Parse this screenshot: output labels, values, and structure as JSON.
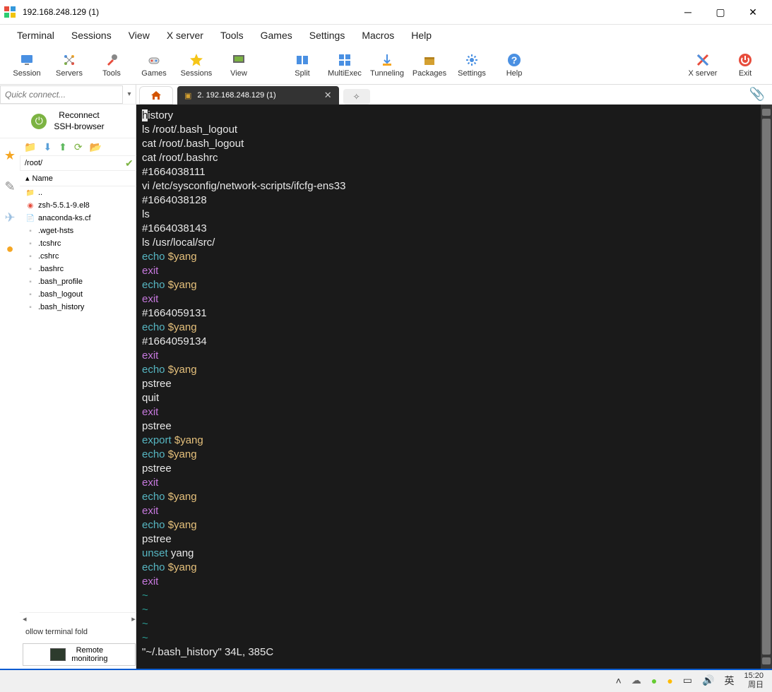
{
  "title": "192.168.248.129 (1)",
  "menu": [
    "Terminal",
    "Sessions",
    "View",
    "X server",
    "Tools",
    "Games",
    "Settings",
    "Macros",
    "Help"
  ],
  "toolbar": [
    {
      "label": "Session",
      "icon": "monitor"
    },
    {
      "label": "Servers",
      "icon": "servers"
    },
    {
      "label": "Tools",
      "icon": "tools"
    },
    {
      "label": "Games",
      "icon": "games"
    },
    {
      "label": "Sessions",
      "icon": "star"
    },
    {
      "label": "View",
      "icon": "view"
    },
    {
      "label": "",
      "icon": ""
    },
    {
      "label": "Split",
      "icon": "split"
    },
    {
      "label": "MultiExec",
      "icon": "multi"
    },
    {
      "label": "Tunneling",
      "icon": "tunnel"
    },
    {
      "label": "Packages",
      "icon": "packages"
    },
    {
      "label": "Settings",
      "icon": "settings"
    },
    {
      "label": "Help",
      "icon": "help"
    }
  ],
  "toolbar_right": [
    {
      "label": "X server",
      "icon": "xserver"
    },
    {
      "label": "Exit",
      "icon": "exit"
    }
  ],
  "quick_connect_placeholder": "Quick connect...",
  "reconnect": {
    "line1": "Reconnect",
    "line2": "SSH-browser"
  },
  "fb_path": "/root/",
  "fb_header": "Name",
  "files": [
    {
      "name": "..",
      "type": "up"
    },
    {
      "name": "zsh-5.5.1-9.el8",
      "type": "rpm"
    },
    {
      "name": "anaconda-ks.cf",
      "type": "doc"
    },
    {
      "name": ".wget-hsts",
      "type": "file"
    },
    {
      "name": ".tcshrc",
      "type": "file"
    },
    {
      "name": ".cshrc",
      "type": "file"
    },
    {
      "name": ".bashrc",
      "type": "file"
    },
    {
      "name": ".bash_profile",
      "type": "file"
    },
    {
      "name": ".bash_logout",
      "type": "file"
    },
    {
      "name": ".bash_history",
      "type": "file"
    }
  ],
  "follow_label": "ollow terminal fold",
  "remote_mon": {
    "line1": "Remote",
    "line2": "monitoring"
  },
  "tab_label": "2. 192.168.248.129 (1)",
  "terminal_lines": [
    [
      {
        "c": "hi",
        "t": "h"
      },
      {
        "c": "c-white",
        "t": "istory"
      }
    ],
    [
      {
        "c": "c-white",
        "t": "ls /root/.bash_logout"
      }
    ],
    [
      {
        "c": "c-white",
        "t": "cat /root/.bash_logout"
      }
    ],
    [
      {
        "c": "c-white",
        "t": "cat /root/.bashrc"
      }
    ],
    [
      {
        "c": "c-white",
        "t": "#1664038111"
      }
    ],
    [
      {
        "c": "c-white",
        "t": "vi /etc/sysconfig/network-scripts/ifcfg-ens33"
      }
    ],
    [
      {
        "c": "c-white",
        "t": "#1664038128"
      }
    ],
    [
      {
        "c": "c-white",
        "t": "ls"
      }
    ],
    [
      {
        "c": "c-white",
        "t": "#1664038143"
      }
    ],
    [
      {
        "c": "c-white",
        "t": "ls /usr/local/src/"
      }
    ],
    [
      {
        "c": "c-cyan",
        "t": "echo"
      },
      {
        "c": "c-white",
        "t": " "
      },
      {
        "c": "c-yellow",
        "t": "$yang"
      }
    ],
    [
      {
        "c": "c-magenta",
        "t": "exit"
      }
    ],
    [
      {
        "c": "c-cyan",
        "t": "echo"
      },
      {
        "c": "c-white",
        "t": " "
      },
      {
        "c": "c-yellow",
        "t": "$yang"
      }
    ],
    [
      {
        "c": "c-magenta",
        "t": "exit"
      }
    ],
    [
      {
        "c": "c-white",
        "t": "#1664059131"
      }
    ],
    [
      {
        "c": "c-cyan",
        "t": "echo"
      },
      {
        "c": "c-white",
        "t": " "
      },
      {
        "c": "c-yellow",
        "t": "$yang"
      }
    ],
    [
      {
        "c": "c-white",
        "t": "#1664059134"
      }
    ],
    [
      {
        "c": "c-magenta",
        "t": "exit"
      }
    ],
    [
      {
        "c": "c-cyan",
        "t": "echo"
      },
      {
        "c": "c-white",
        "t": " "
      },
      {
        "c": "c-yellow",
        "t": "$yang"
      }
    ],
    [
      {
        "c": "c-white",
        "t": "pstree"
      }
    ],
    [
      {
        "c": "c-white",
        "t": "quit"
      }
    ],
    [
      {
        "c": "c-magenta",
        "t": "exit"
      }
    ],
    [
      {
        "c": "c-white",
        "t": "pstree"
      }
    ],
    [
      {
        "c": "c-cyan",
        "t": "export"
      },
      {
        "c": "c-white",
        "t": " "
      },
      {
        "c": "c-yellow",
        "t": "$yang"
      }
    ],
    [
      {
        "c": "c-cyan",
        "t": "echo"
      },
      {
        "c": "c-white",
        "t": " "
      },
      {
        "c": "c-yellow",
        "t": "$yang"
      }
    ],
    [
      {
        "c": "c-white",
        "t": "pstree"
      }
    ],
    [
      {
        "c": "c-magenta",
        "t": "exit"
      }
    ],
    [
      {
        "c": "c-cyan",
        "t": "echo"
      },
      {
        "c": "c-white",
        "t": " "
      },
      {
        "c": "c-yellow",
        "t": "$yang"
      }
    ],
    [
      {
        "c": "c-magenta",
        "t": "exit"
      }
    ],
    [
      {
        "c": "c-cyan",
        "t": "echo"
      },
      {
        "c": "c-white",
        "t": " "
      },
      {
        "c": "c-yellow",
        "t": "$yang"
      }
    ],
    [
      {
        "c": "c-white",
        "t": "pstree"
      }
    ],
    [
      {
        "c": "c-cyan",
        "t": "unset"
      },
      {
        "c": "c-white",
        "t": " yang"
      }
    ],
    [
      {
        "c": "c-cyan",
        "t": "echo"
      },
      {
        "c": "c-white",
        "t": " "
      },
      {
        "c": "c-yellow",
        "t": "$yang"
      }
    ],
    [
      {
        "c": "c-magenta",
        "t": "exit"
      }
    ],
    [
      {
        "c": "c-teal",
        "t": "~"
      }
    ],
    [
      {
        "c": "c-teal",
        "t": "~"
      }
    ],
    [
      {
        "c": "c-teal",
        "t": "~"
      }
    ],
    [
      {
        "c": "c-teal",
        "t": "~"
      }
    ],
    [
      {
        "c": "c-white",
        "t": "\"~/.bash_history\" 34L, 385C"
      }
    ]
  ],
  "taskbar": {
    "time": "15:20",
    "day": "周日",
    "ime": "英"
  }
}
